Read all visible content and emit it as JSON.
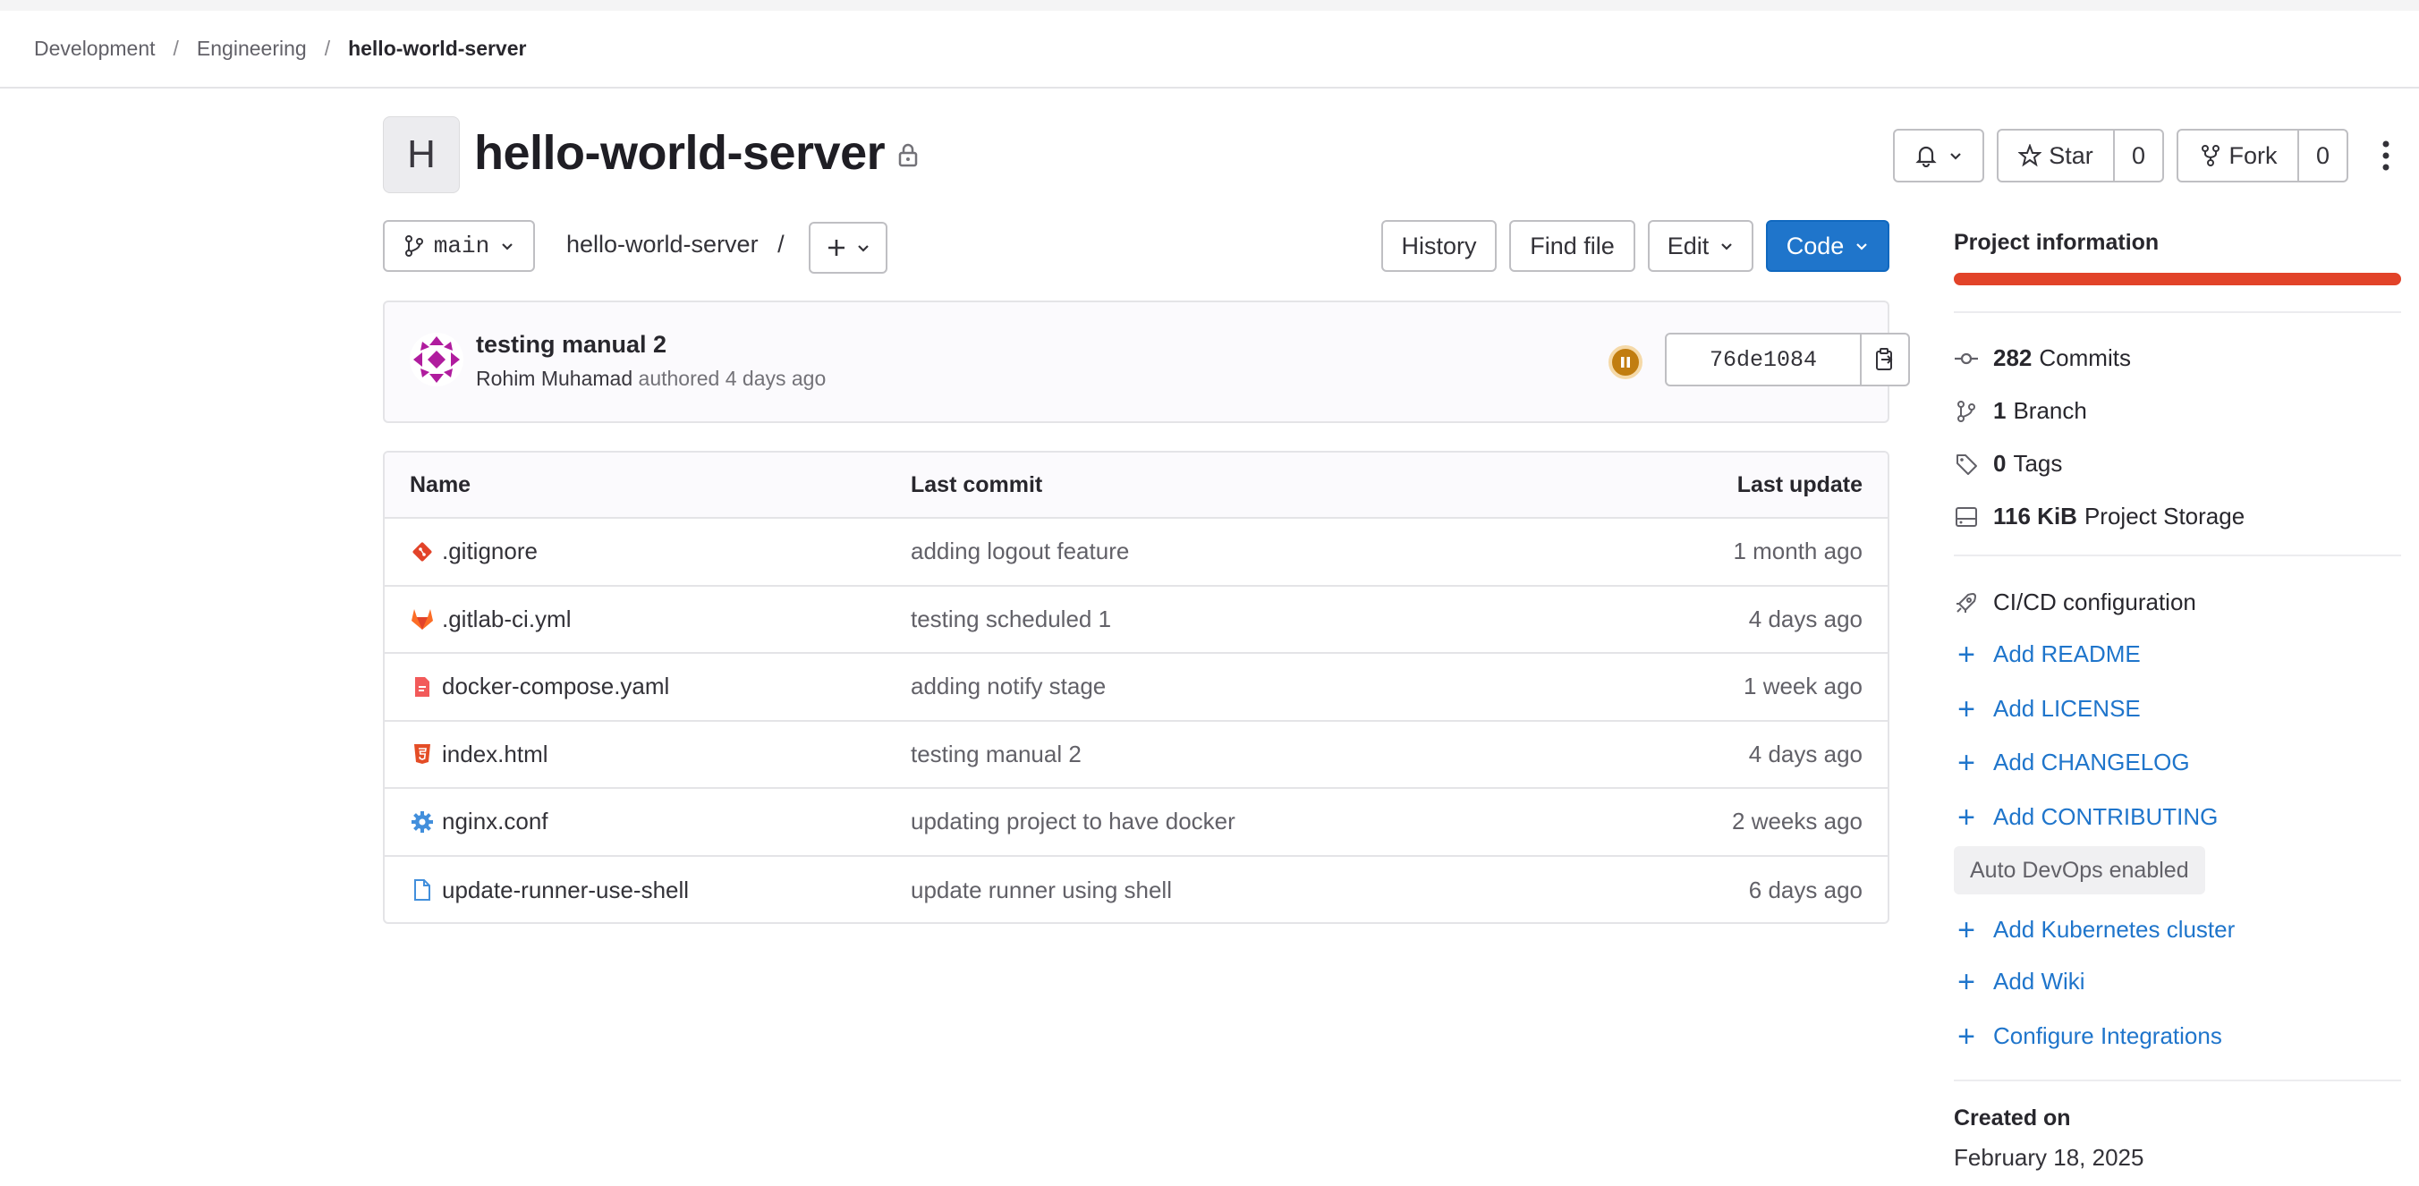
{
  "breadcrumbs": [
    "Development",
    "Engineering",
    "hello-world-server"
  ],
  "project": {
    "avatar_letter": "H",
    "name": "hello-world-server"
  },
  "header_actions": {
    "star_label": "Star",
    "star_count": "0",
    "fork_label": "Fork",
    "fork_count": "0"
  },
  "toolbar": {
    "branch": "main",
    "path": "hello-world-server",
    "path_sep": "/",
    "history": "History",
    "find_file": "Find file",
    "edit": "Edit",
    "code": "Code"
  },
  "last_commit": {
    "title": "testing manual 2",
    "author": "Rohim Muhamad",
    "authored_text": "authored 4 days ago",
    "sha": "76de1084",
    "pipeline_status": "paused",
    "pipeline_color": "#c17d10"
  },
  "files": {
    "headers": {
      "name": "Name",
      "last_commit": "Last commit",
      "last_update": "Last update"
    },
    "rows": [
      {
        "name": ".gitignore",
        "commit": "adding logout feature",
        "updated": "1 month ago",
        "icon": "git-icon"
      },
      {
        "name": ".gitlab-ci.yml",
        "commit": "testing scheduled 1",
        "updated": "4 days ago",
        "icon": "gitlab-icon"
      },
      {
        "name": "docker-compose.yaml",
        "commit": "adding notify stage",
        "updated": "1 week ago",
        "icon": "yaml-file-icon"
      },
      {
        "name": "index.html",
        "commit": "testing manual 2",
        "updated": "4 days ago",
        "icon": "html5-icon"
      },
      {
        "name": "nginx.conf",
        "commit": "updating project to have docker",
        "updated": "2 weeks ago",
        "icon": "gear-icon"
      },
      {
        "name": "update-runner-use-shell",
        "commit": "update runner using shell",
        "updated": "6 days ago",
        "icon": "file-icon"
      }
    ]
  },
  "sidebar": {
    "title": "Project information",
    "stats": [
      {
        "value": "282",
        "label": "Commits",
        "icon": "commit-icon"
      },
      {
        "value": "1",
        "label": "Branch",
        "icon": "branch-icon"
      },
      {
        "value": "0",
        "label": "Tags",
        "icon": "tag-icon"
      },
      {
        "value": "116 KiB",
        "label": "Project Storage",
        "icon": "storage-icon"
      }
    ],
    "cicd": "CI/CD configuration",
    "links1": [
      "Add README",
      "Add LICENSE",
      "Add CHANGELOG",
      "Add CONTRIBUTING"
    ],
    "auto_devops": "Auto DevOps enabled",
    "links2": [
      "Add Kubernetes cluster",
      "Add Wiki",
      "Configure Integrations"
    ],
    "created_label": "Created on",
    "created_date": "February 18, 2025"
  },
  "colors": {
    "accent": "#1f75cb",
    "language_bar": "#e24329"
  }
}
